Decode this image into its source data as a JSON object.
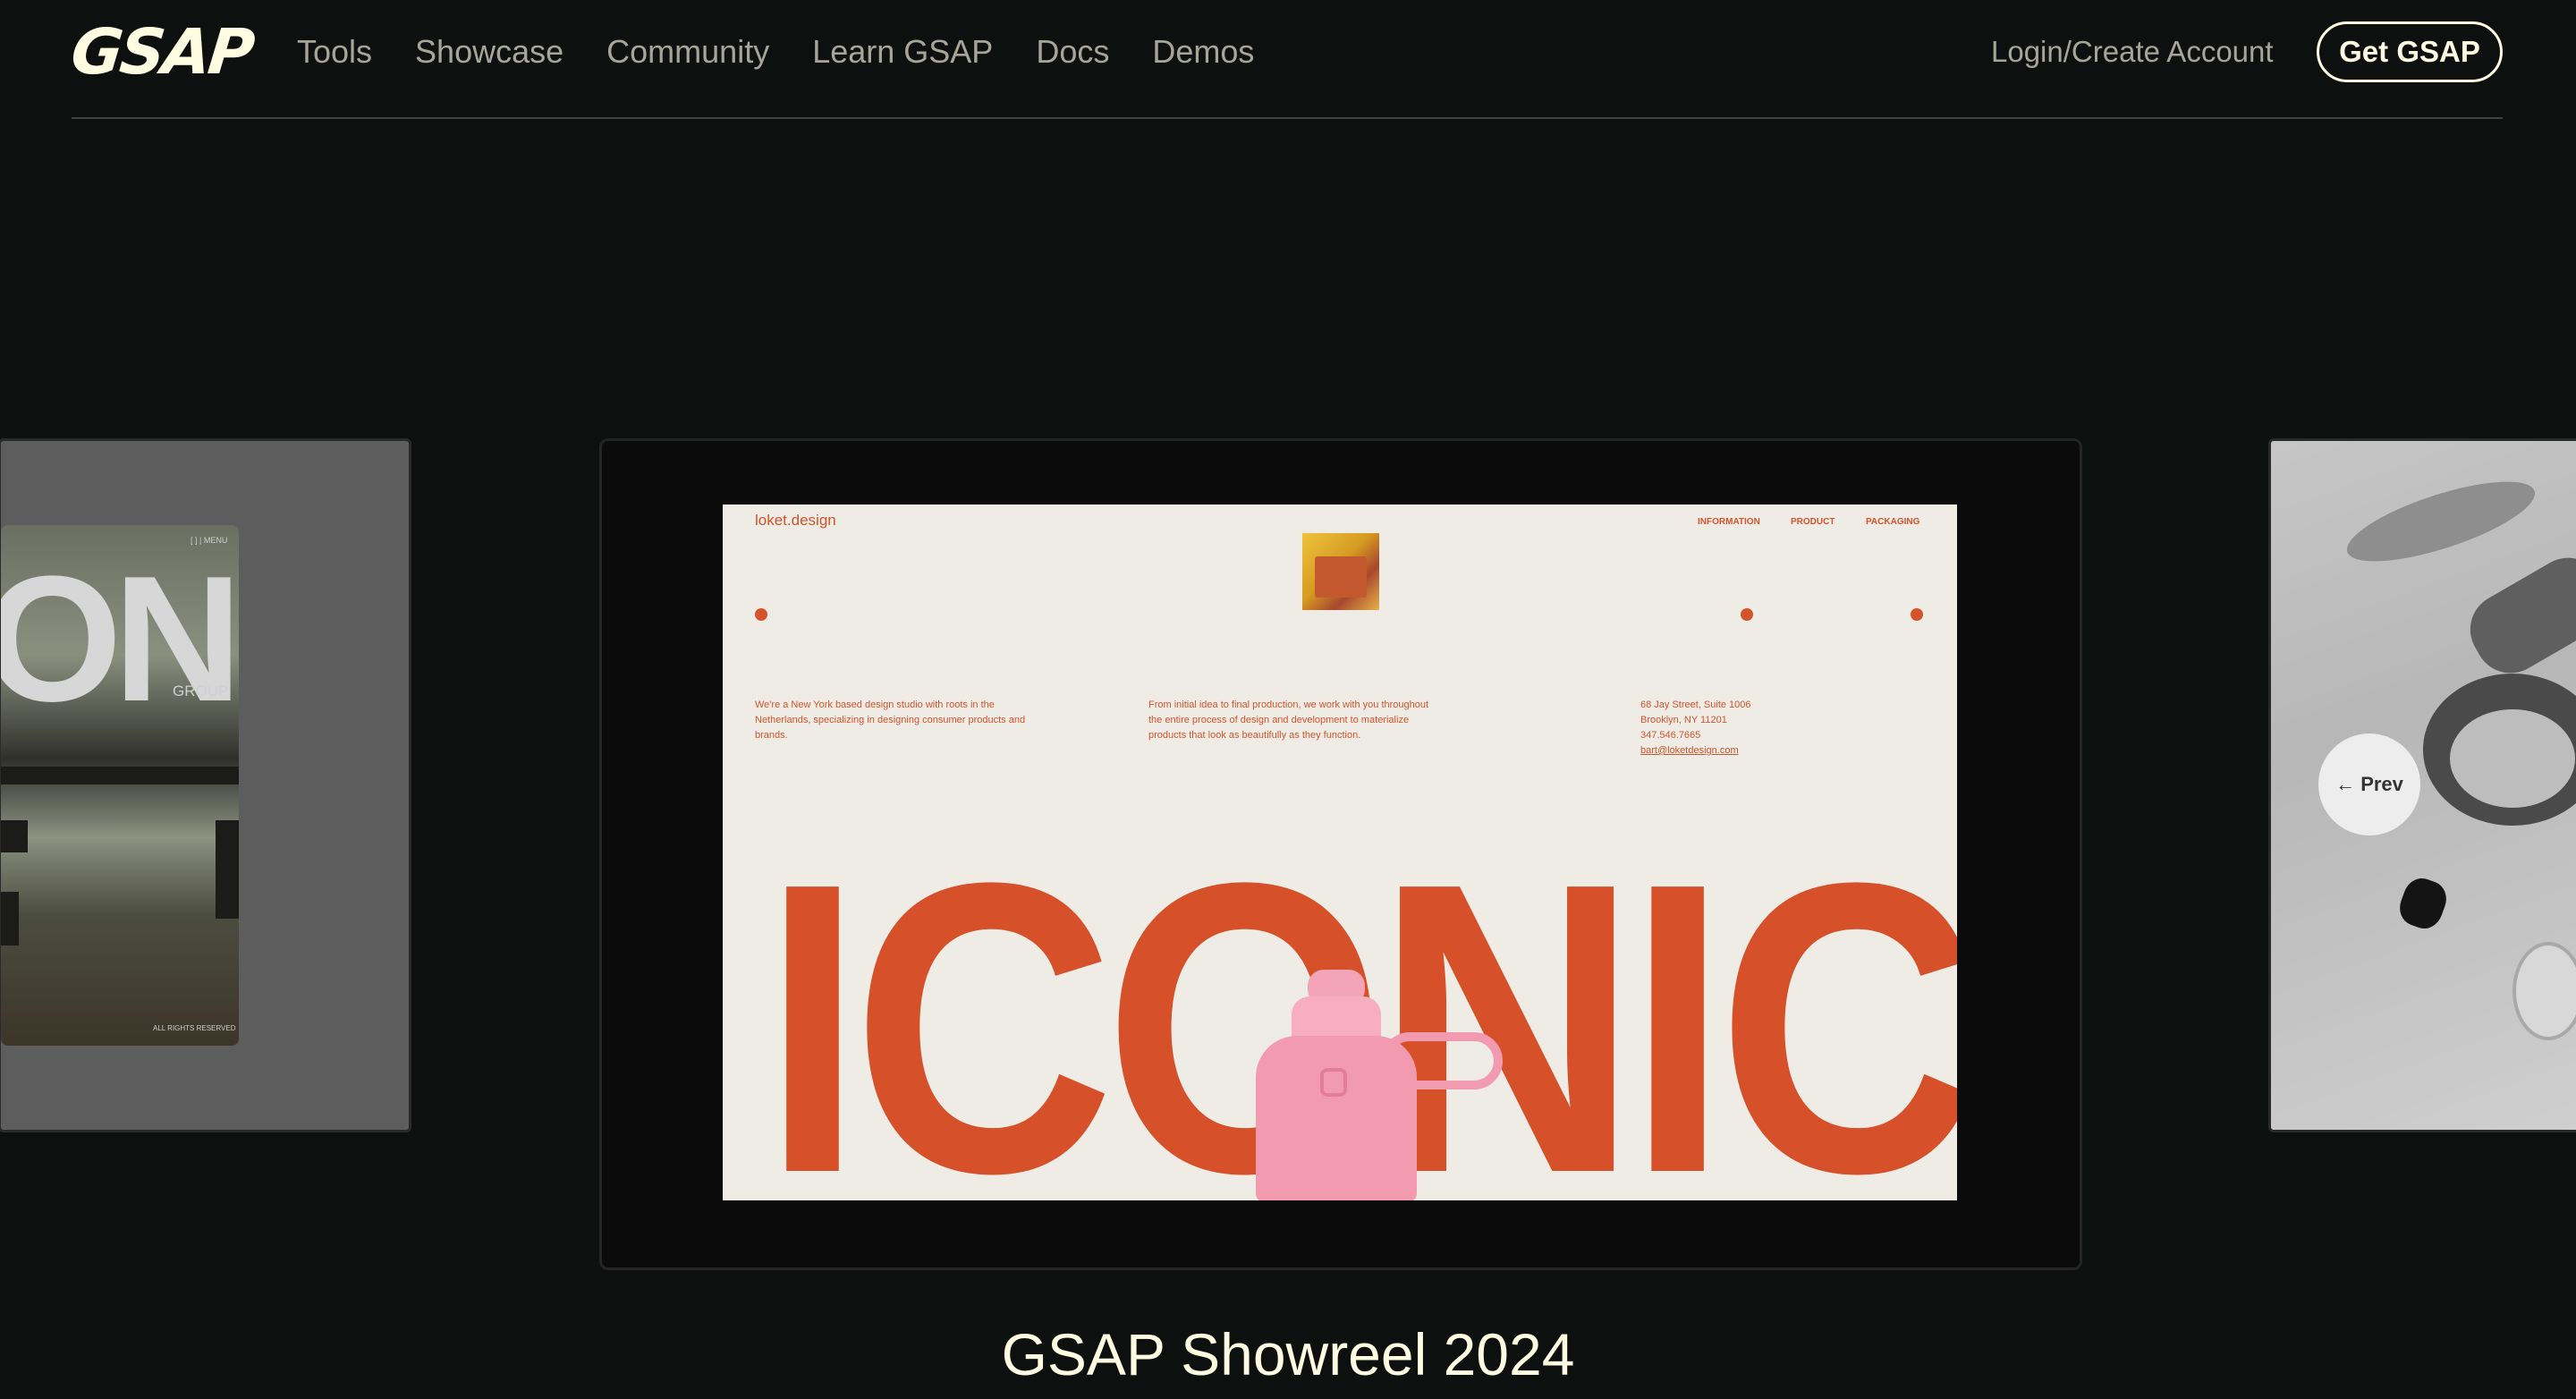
{
  "nav": {
    "logo": "GSAP",
    "links": [
      "Tools",
      "Showcase",
      "Community",
      "Learn GSAP",
      "Docs",
      "Demos"
    ],
    "login": "Login/Create Account",
    "cta": "Get GSAP"
  },
  "carousel": {
    "left_card": {
      "big_text": "ON",
      "sub_text": "GROUP",
      "footer": "ALL RIGHTS RESERVED",
      "corner": "[ ] | MENU"
    },
    "main_card": {
      "site_logo": "loket.design",
      "site_nav": [
        "INFORMATION",
        "PRODUCT",
        "PACKAGING"
      ],
      "para1": "We're a New York based design studio with roots in the Netherlands, specializing in designing consumer products and brands.",
      "para2": "From initial idea to final production, we work with you throughout the entire process of design and development to materialize products that look as beautifully as they function.",
      "address": [
        "68 Jay Street, Suite 1006",
        "Brooklyn, NY 11201",
        "347.546.7665"
      ],
      "email": "bart@loketdesign.com",
      "hero": "ICONIC"
    },
    "prev_label": "← Prev"
  },
  "caption": "GSAP Showreel 2024",
  "colors": {
    "background": "#0e100f",
    "cream": "#fffce1",
    "accent": "#d6502a"
  }
}
